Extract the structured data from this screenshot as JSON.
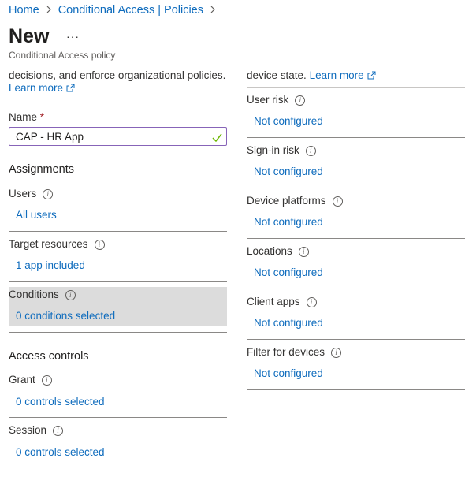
{
  "breadcrumb": {
    "items": [
      "Home",
      "Conditional Access | Policies"
    ]
  },
  "header": {
    "title": "New",
    "more_label": "···",
    "subtitle": "Conditional Access policy"
  },
  "left": {
    "intro_text": "decisions, and enforce organizational policies.",
    "learn_more": "Learn more",
    "name": {
      "label": "Name",
      "required_mark": "*",
      "value": "CAP - HR App"
    },
    "assignments_heading": "Assignments",
    "users": {
      "label": "Users",
      "value": "All users"
    },
    "target_resources": {
      "label": "Target resources",
      "value": "1 app included"
    },
    "conditions": {
      "label": "Conditions",
      "value": "0 conditions selected"
    },
    "access_controls_heading": "Access controls",
    "grant": {
      "label": "Grant",
      "value": "0 controls selected"
    },
    "session": {
      "label": "Session",
      "value": "0 controls selected"
    }
  },
  "right": {
    "intro_text": "device state.",
    "learn_more": "Learn more",
    "items": [
      {
        "label": "User risk",
        "value": "Not configured"
      },
      {
        "label": "Sign-in risk",
        "value": "Not configured"
      },
      {
        "label": "Device platforms",
        "value": "Not configured"
      },
      {
        "label": "Locations",
        "value": "Not configured"
      },
      {
        "label": "Client apps",
        "value": "Not configured"
      },
      {
        "label": "Filter for devices",
        "value": "Not configured"
      }
    ]
  },
  "colors": {
    "link": "#0f6cbd",
    "input_border": "#8764b8",
    "valid_check": "#6bb700",
    "selected_row": "#dcdcdc"
  },
  "icons": [
    "chevron-right-icon",
    "info-icon",
    "external-link-icon",
    "checkmark-icon"
  ]
}
